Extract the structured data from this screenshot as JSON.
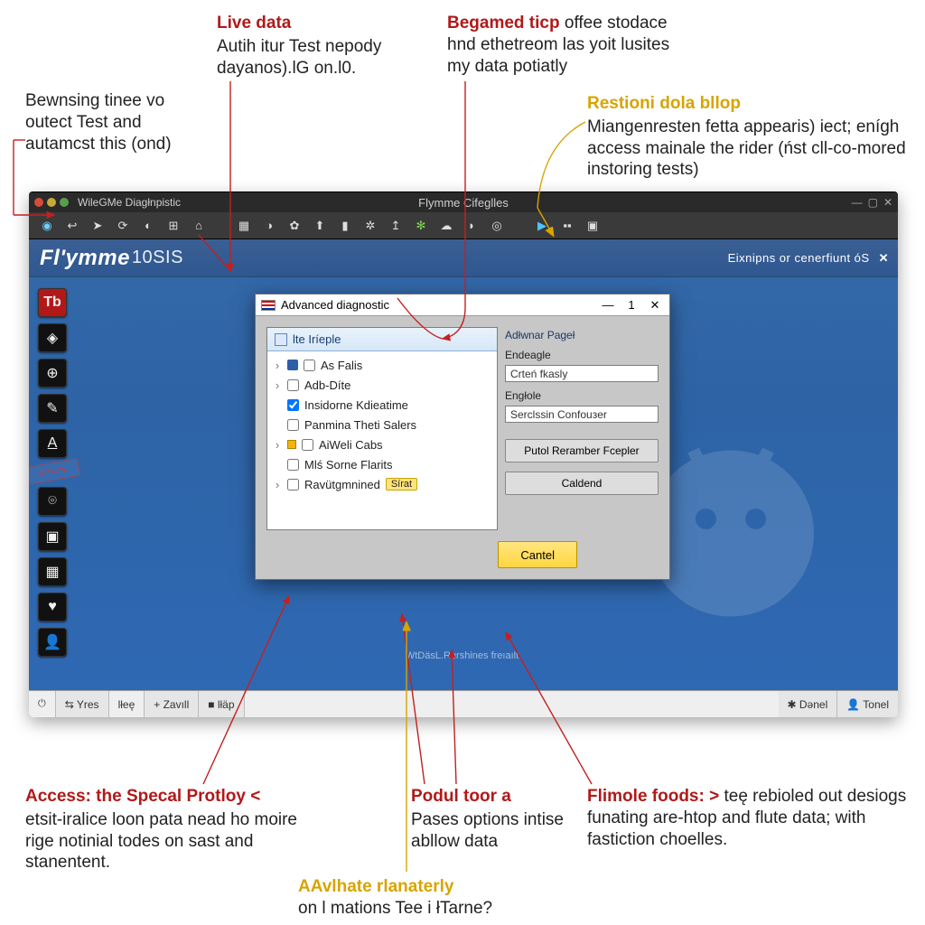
{
  "annotations": {
    "a1": {
      "title": "",
      "body": "Bewnsing tinee vo outect Test and autamcst this (ond)"
    },
    "a2": {
      "title": "Live data",
      "body": "Autih itur Test nepody dayanos).lG on.l0."
    },
    "a3": {
      "title": "Begamed ticp",
      "body": "offee stodace hnd ethetreom las yoit lusites my data potiatly"
    },
    "a4": {
      "title": "Restioni dola bllop",
      "body": "Miangenresten fetta appearis) iect; enígh access mainale the rider (ńst cll-co-mored instoring tests)"
    },
    "a5": {
      "title": "Access: the Specal Protloy <",
      "body": "etsit-iralice loon pata nead ho moire rige notinial todes on sast and stanentent."
    },
    "a6": {
      "title": "Podul toor a",
      "body": "Pases options intise abllow data"
    },
    "a7": {
      "title": "AAvlhate rlanaterly",
      "body": "on l mations Tee i łTarne?"
    },
    "a8": {
      "title": "Flimole foods: >",
      "body": "teę rebioled out desiogs funating are-htop and flute data; with fastiction choelles."
    }
  },
  "titlebar": {
    "left": "WileGMe Diagłnpistic",
    "center": "Flymme Cifeglles"
  },
  "toolbar_icons": [
    "globe",
    "back",
    "fwd",
    "sync",
    "refresh",
    "windows",
    "home",
    "",
    "grid",
    "bulb",
    "gear",
    "upload",
    "folder",
    "burst",
    "send",
    "leaf",
    "cloud",
    "tag",
    "disc",
    "",
    "play",
    "pause",
    "screen"
  ],
  "brand": {
    "bold": "Fl'ymme",
    "light": "10SIS"
  },
  "banner": {
    "text": "Eixnipns or cenerfiunt óS",
    "close": "✕"
  },
  "left_rail": [
    "Tb",
    "◈",
    "⊕",
    "✎",
    "A",
    "stamp",
    "⌾",
    "▣",
    "▦",
    "♥",
    "👤"
  ],
  "stamp_label": "dnTnchy",
  "statusbar": {
    "seg1": "",
    "seg2": "⇆  Yres",
    "seg3": "lłeę",
    "seg4": "+  Zavıll",
    "seg5": "■  lłäp",
    "hint": "WtDäsL.Rurshines freıaılt.",
    "segR1": "✱  Dənel",
    "segR2": "👤  Tonel"
  },
  "dialog": {
    "title": "Advanced diagnostic",
    "count": "1",
    "left_head": "lte Iríeple",
    "tree": [
      {
        "caret": "›",
        "icon": "b",
        "checked": false,
        "label": "As Falis"
      },
      {
        "caret": "›",
        "icon": "",
        "checked": false,
        "label": "Adb-Díte"
      },
      {
        "caret": "",
        "icon": "",
        "checked": true,
        "label": "Insidorne Kdieatime"
      },
      {
        "caret": "",
        "icon": "",
        "checked": false,
        "label": "Panmina Theti Salers"
      },
      {
        "caret": "›",
        "icon": "y",
        "checked": false,
        "label": "AiWeli Cabs"
      },
      {
        "caret": "",
        "icon": "",
        "checked": false,
        "label": "Mlś Sorne Flarits"
      },
      {
        "caret": "›",
        "icon": "",
        "checked": false,
        "label": "Ravütgmnined",
        "chip": "Sírat"
      }
    ],
    "right": {
      "h": "Adłwnar Pageł",
      "l1": "Endeagle",
      "v1": "Crteń fkasly",
      "l2": "Engłole",
      "v2": "Serclssin Confouзer"
    },
    "btn_put": "Putol Reramber Fcepler",
    "btn_caldend": "Caldend",
    "btn_cancel": "Cantel"
  }
}
